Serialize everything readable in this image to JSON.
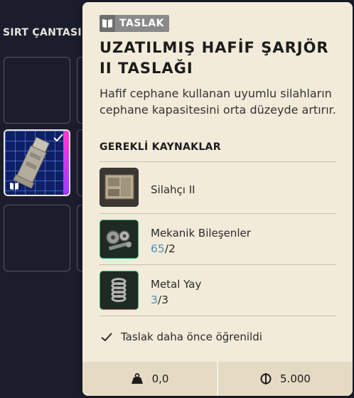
{
  "inventory": {
    "title": "SIRT ÇANTASI"
  },
  "tooltip": {
    "badge_label": "TASLAK",
    "title": "UZATILMIŞ HAFİF ŞARJÖR II TASLAĞI",
    "description": "Hafif cephane kullanan uyumlu silahların cephane kapasitesini orta düzeyde artırır.",
    "requirements_heading": "GEREKLİ KAYNAKLAR",
    "resources": [
      {
        "name": "Silahçı II",
        "icon": "workbench-icon",
        "have": "",
        "sep": "",
        "need": ""
      },
      {
        "name": "Mekanik Bileşenler",
        "icon": "gears-icon",
        "have": "65",
        "sep": "/",
        "need": "2"
      },
      {
        "name": "Metal Yay",
        "icon": "spring-icon",
        "have": "3",
        "sep": "/",
        "need": "3"
      }
    ],
    "learned_text": "Taslak daha önce öğrenildi",
    "weight": "0,0",
    "price": "5.000"
  },
  "colors": {
    "panel_bg": "#f2ebd9",
    "qty_have": "#4d8fb6",
    "rarity_accent": "#3ea86e"
  }
}
